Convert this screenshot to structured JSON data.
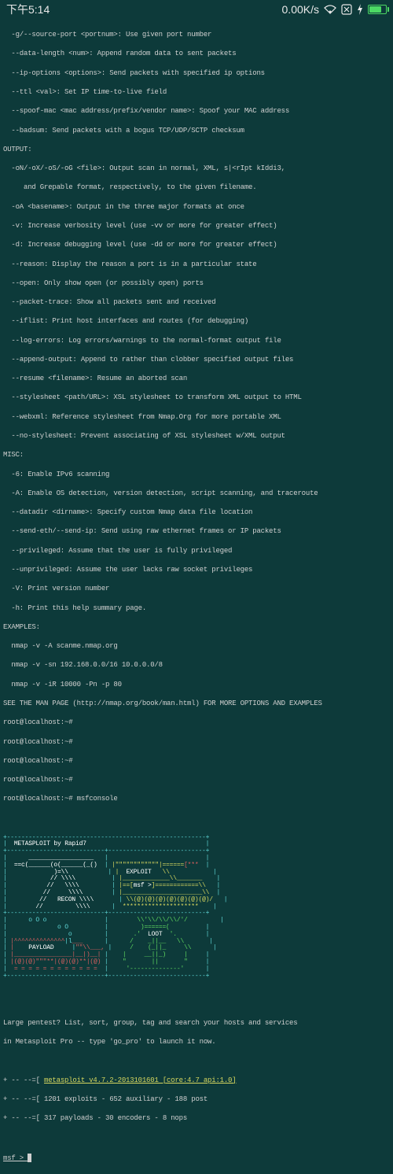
{
  "status_bar": {
    "time": "下午5:14",
    "net_speed": "0.00K/s"
  },
  "help_lines": [
    "  -g/--source-port <portnum>: Use given port number",
    "  --data-length <num>: Append random data to sent packets",
    "  --ip-options <options>: Send packets with specified ip options",
    "  --ttl <val>: Set IP time-to-live field",
    "  --spoof-mac <mac address/prefix/vendor name>: Spoof your MAC address",
    "  --badsum: Send packets with a bogus TCP/UDP/SCTP checksum"
  ],
  "output_hdr": "OUTPUT:",
  "output_lines": [
    "  -oN/-oX/-oS/-oG <file>: Output scan in normal, XML, s|<rIpt kIddi3,",
    "     and Grepable format, respectively, to the given filename.",
    "  -oA <basename>: Output in the three major formats at once",
    "  -v: Increase verbosity level (use -vv or more for greater effect)",
    "  -d: Increase debugging level (use -dd or more for greater effect)",
    "  --reason: Display the reason a port is in a particular state",
    "  --open: Only show open (or possibly open) ports",
    "  --packet-trace: Show all packets sent and received",
    "  --iflist: Print host interfaces and routes (for debugging)",
    "  --log-errors: Log errors/warnings to the normal-format output file",
    "  --append-output: Append to rather than clobber specified output files",
    "  --resume <filename>: Resume an aborted scan",
    "  --stylesheet <path/URL>: XSL stylesheet to transform XML output to HTML",
    "  --webxml: Reference stylesheet from Nmap.Org for more portable XML",
    "  --no-stylesheet: Prevent associating of XSL stylesheet w/XML output"
  ],
  "misc_hdr": "MISC:",
  "misc_lines": [
    "  -6: Enable IPv6 scanning",
    "  -A: Enable OS detection, version detection, script scanning, and traceroute",
    "  --datadir <dirname>: Specify custom Nmap data file location",
    "  --send-eth/--send-ip: Send using raw ethernet frames or IP packets",
    "  --privileged: Assume that the user is fully privileged",
    "  --unprivileged: Assume the user lacks raw socket privileges",
    "  -V: Print version number",
    "  -h: Print this help summary page."
  ],
  "examples_hdr": "EXAMPLES:",
  "examples_lines": [
    "  nmap -v -A scanme.nmap.org",
    "  nmap -v -sn 192.168.0.0/16 10.0.0.0/8",
    "  nmap -v -iR 10000 -Pn -p 80"
  ],
  "manpage_line": "SEE THE MAN PAGE (http://nmap.org/book/man.html) FOR MORE OPTIONS AND EXAMPLES",
  "prompts": [
    "root@localhost:~#",
    "root@localhost:~#",
    "root@localhost:~#",
    "root@localhost:~#"
  ],
  "msf_cmd_prompt": "root@localhost:~# ",
  "msf_cmd": "msfconsole",
  "banner_title": "METASPLOIT by Rapid7",
  "banner_labels": {
    "recon": "RECON",
    "exploit": "EXPLOIT",
    "payload": "PAYLOAD",
    "loot": "LOOT",
    "msf_inner": "msf >"
  },
  "tagline1": "Large pentest? List, sort, group, tag and search your hosts and services",
  "tagline2": "in Metasploit Pro -- type 'go_pro' to launch it now.",
  "version_prefix": "+ -- --=[ ",
  "version_text": "metasploit v4.7.2-2013101601 [core:4.7 api:1.0]",
  "stats1": "+ -- --=[ 1201 exploits - 652 auxiliary - 188 post",
  "stats2": "+ -- --=[ 317 payloads - 30 encoders - 8 nops",
  "final_prompt": "msf > "
}
